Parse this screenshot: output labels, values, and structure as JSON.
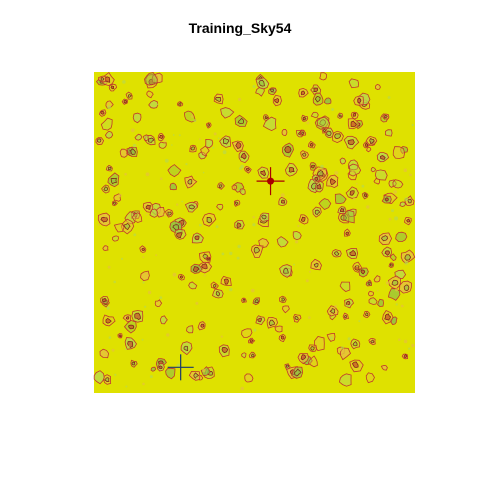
{
  "chart_data": {
    "type": "heatmap",
    "title": "Training_Sky54",
    "xlabel": "",
    "ylabel": "",
    "grid": false,
    "legend": "none",
    "colors": {
      "background": "#dfe100",
      "contour": "#c0392b",
      "contour_dark": "#7a1a1a",
      "blob_light": "#b9d94a",
      "blob_mid": "#8fbf44",
      "blob_warm": "#e6c23a",
      "halo_marker": "#aa0000",
      "halo_center_marker": "#1a3a6b"
    },
    "markers": [
      {
        "name": "halo",
        "x": 0.55,
        "y": 0.66,
        "symbol": "cross-with-dot"
      },
      {
        "name": "halo-center",
        "x": 0.27,
        "y": 0.08,
        "symbol": "cross"
      }
    ]
  }
}
